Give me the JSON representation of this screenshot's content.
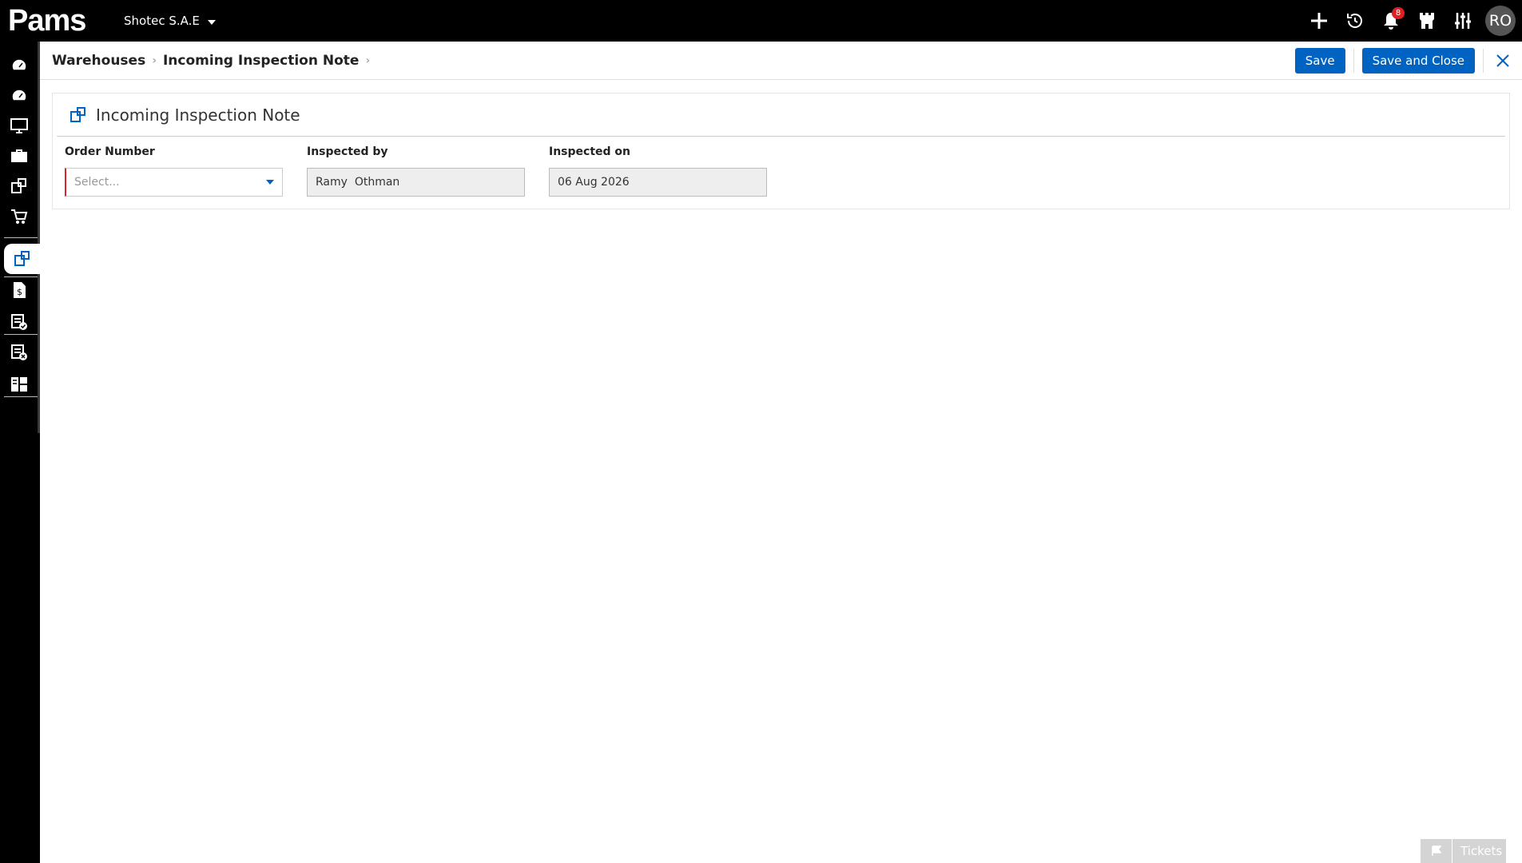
{
  "app": {
    "logo_text": "Pams",
    "company": "Shotec S.A.E"
  },
  "topbar": {
    "notifications_count": "8",
    "avatar_initials": "RO",
    "icons": [
      "plus-icon",
      "history-icon",
      "bell-icon",
      "castle-icon",
      "sliders-icon"
    ]
  },
  "sidebar": {
    "items": [
      {
        "name": "dashboard-icon"
      },
      {
        "name": "dashboard-alt-icon"
      },
      {
        "name": "monitor-icon"
      },
      {
        "name": "briefcase-icon"
      },
      {
        "name": "warehouse-transfer-icon"
      },
      {
        "name": "shopping-cart-icon"
      },
      {
        "name": "incoming-inspection-icon",
        "active": true
      },
      {
        "name": "invoice-dollar-icon"
      },
      {
        "name": "checklist-approved-icon"
      },
      {
        "name": "checklist-rejected-icon"
      },
      {
        "name": "reports-grid-icon"
      }
    ]
  },
  "breadcrumb": {
    "items": [
      "Warehouses",
      "Incoming Inspection Note"
    ]
  },
  "toolbar": {
    "save_label": "Save",
    "save_close_label": "Save and Close"
  },
  "form": {
    "title": "Incoming Inspection Note",
    "order_number": {
      "label": "Order Number",
      "placeholder": "Select..."
    },
    "inspected_by": {
      "label": "Inspected by",
      "value": "Ramy  Othman"
    },
    "inspected_on": {
      "label": "Inspected on",
      "value": "06 Aug 2026"
    }
  },
  "tickets": {
    "label": "Tickets"
  },
  "colors": {
    "primary": "#0063c1",
    "topbar_bg": "#000000",
    "required_marker": "#d9232d",
    "badge": "#e02020"
  }
}
